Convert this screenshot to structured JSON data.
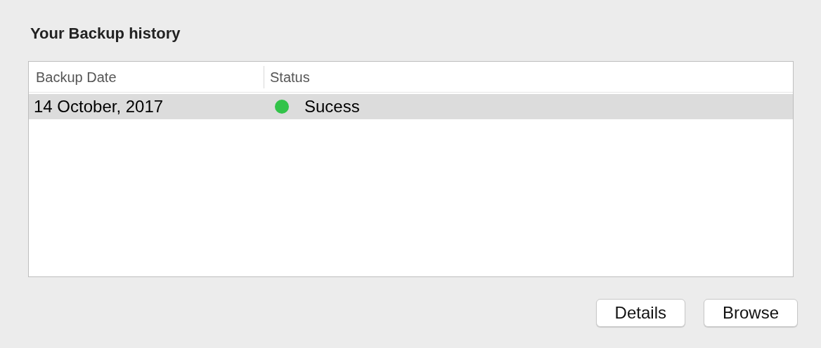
{
  "title": "Your Backup history",
  "table": {
    "columns": [
      "Backup Date",
      "Status"
    ],
    "rows": [
      {
        "date": "14 October, 2017",
        "status": "Sucess",
        "color": "#32c349",
        "selected": true
      }
    ]
  },
  "buttons": [
    "Details",
    "Browse"
  ]
}
